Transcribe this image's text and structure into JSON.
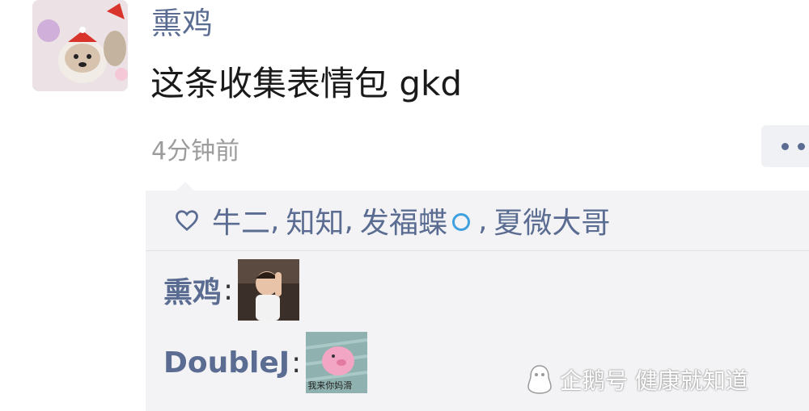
{
  "post": {
    "author": "熏鸡",
    "content": "这条收集表情包 gkd",
    "timestamp": "4分钟前"
  },
  "likes": {
    "names": [
      "牛二",
      "知知",
      "发福蝶",
      "夏微大哥"
    ],
    "separator": ",",
    "icon": "heart-outline-icon"
  },
  "comments": [
    {
      "author": "熏鸡",
      "colon": ":",
      "sticker": "baby-sticker"
    },
    {
      "author": "DoubleJ",
      "colon": ":",
      "sticker": "pink-pig-sticker",
      "sticker_caption": "我来你妈滑"
    }
  ],
  "watermark": {
    "text": "企鹅号 健康就知道",
    "icon": "penguin-icon"
  },
  "colors": {
    "link": "#5a6c91",
    "panel": "#f3f3f5",
    "timestamp": "#9c9c9c"
  }
}
